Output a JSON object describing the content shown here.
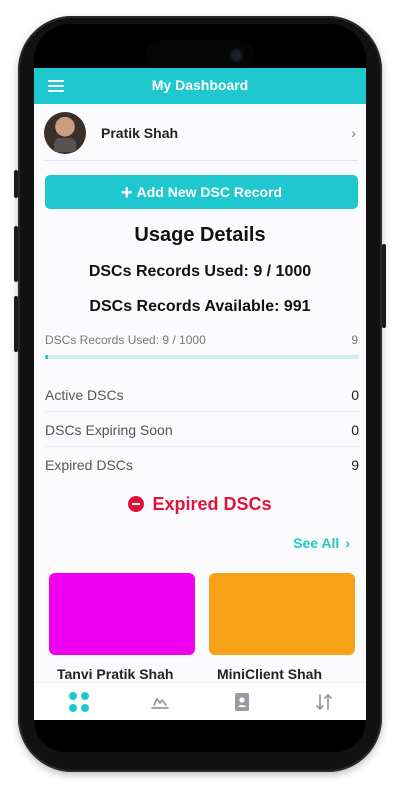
{
  "header": {
    "title": "My Dashboard"
  },
  "profile": {
    "name": "Pratik Shah"
  },
  "actions": {
    "add_label": "Add New DSC Record"
  },
  "usage": {
    "title": "Usage Details",
    "used_line": "DSCs Records Used: 9 / 1000",
    "available_line": "DSCs Records Available: 991",
    "progress_label": "DSCs Records Used: 9 / 1000",
    "progress_count": "9",
    "progress_fraction": 0.009
  },
  "stats": [
    {
      "label": "Active DSCs",
      "value": "0"
    },
    {
      "label": "DSCs Expiring Soon",
      "value": "0"
    },
    {
      "label": "Expired DSCs",
      "value": "9"
    }
  ],
  "expired": {
    "heading": "Expired DSCs",
    "see_all": "See All",
    "cards": [
      {
        "name": "Tanvi Pratik Shah",
        "color": "#f000f0"
      },
      {
        "name": "MiniClient Shah",
        "color": "#f8a316"
      }
    ]
  },
  "colors": {
    "accent": "#1fc8cf",
    "danger": "#e0133d"
  },
  "tabbar": {
    "items": [
      {
        "icon": "dashboard-grid-icon"
      },
      {
        "icon": "signature-icon"
      },
      {
        "icon": "contacts-icon"
      },
      {
        "icon": "sort-icon"
      }
    ]
  }
}
